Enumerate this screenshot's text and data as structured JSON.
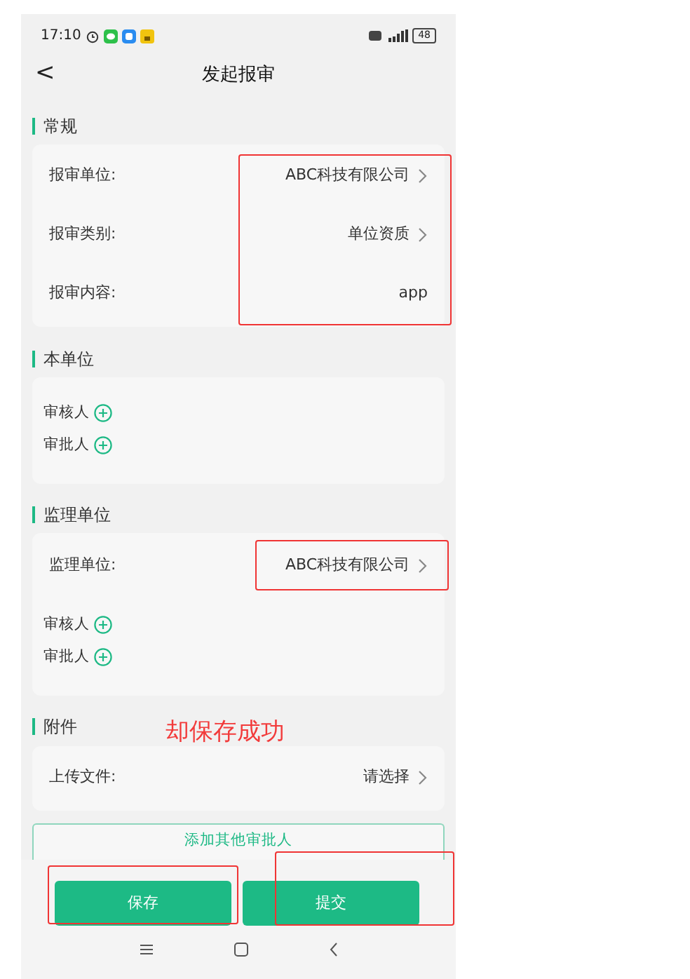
{
  "status_bar": {
    "time": "17:10",
    "battery": "48"
  },
  "header": {
    "back": "<",
    "title": "发起报审"
  },
  "sections": [
    {
      "title": "常规",
      "rows": [
        {
          "kind": "field",
          "label": "报审单位:",
          "value": "ABC科技有限公司",
          "chevron": true
        },
        {
          "kind": "field",
          "label": "报审类别:",
          "value": "单位资质",
          "chevron": true
        },
        {
          "kind": "field",
          "label": "报审内容:",
          "value": "app",
          "chevron": false
        }
      ]
    },
    {
      "title": "本单位",
      "rows": [
        {
          "kind": "person",
          "label": "审核人"
        },
        {
          "kind": "person",
          "label": "审批人"
        }
      ]
    },
    {
      "title": "监理单位",
      "rows": [
        {
          "kind": "field",
          "label": "监理单位:",
          "value": "ABC科技有限公司",
          "chevron": true
        },
        {
          "kind": "person",
          "label": "审核人"
        },
        {
          "kind": "person",
          "label": "审批人"
        }
      ]
    },
    {
      "title": "附件",
      "rows": [
        {
          "kind": "field",
          "label": "上传文件:",
          "value": "请选择",
          "chevron": true
        }
      ]
    }
  ],
  "add_approver": "添加其他审批人",
  "buttons": [
    "保存",
    "提交"
  ],
  "annotation": {
    "note": "却保存成功"
  }
}
